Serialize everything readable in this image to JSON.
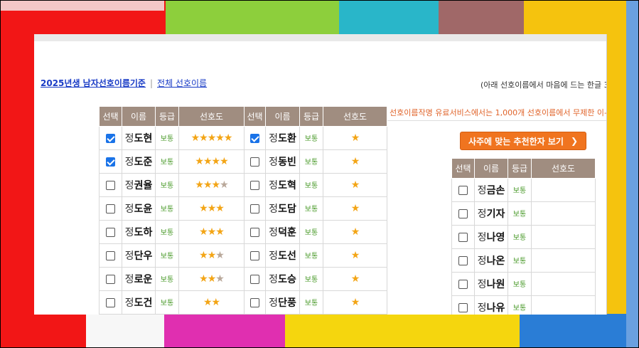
{
  "links": {
    "primary": "2025년생 남자선호이름기준",
    "separator": "|",
    "secondary": "전체 선호이름"
  },
  "note": "(아래 선호이름에서 마음에 드는 한글 3",
  "promo": "선호이름작명 유료서비스에서는 1,000개 선호이름에서 무제한 이-",
  "button": {
    "label": "사주에 맞는 추천한자 보기",
    "icon": "chevron-right-icon"
  },
  "headers": {
    "select": "선택",
    "name": "이름",
    "grade": "등급",
    "pref": "선호도"
  },
  "left_rows": [
    {
      "checked": true,
      "surname": "정",
      "given": "도현",
      "grade": "보통",
      "stars": 5
    },
    {
      "checked": true,
      "surname": "정",
      "given": "도준",
      "grade": "보통",
      "stars": 4
    },
    {
      "checked": false,
      "surname": "정",
      "given": "권율",
      "grade": "보통",
      "stars": 3.5
    },
    {
      "checked": false,
      "surname": "정",
      "given": "도윤",
      "grade": "보통",
      "stars": 3
    },
    {
      "checked": false,
      "surname": "정",
      "given": "도하",
      "grade": "보통",
      "stars": 3
    },
    {
      "checked": false,
      "surname": "정",
      "given": "단우",
      "grade": "보통",
      "stars": 2.5
    },
    {
      "checked": false,
      "surname": "정",
      "given": "로운",
      "grade": "보통",
      "stars": 2.5
    },
    {
      "checked": false,
      "surname": "정",
      "given": "도건",
      "grade": "보통",
      "stars": 2
    }
  ],
  "mid_rows": [
    {
      "checked": true,
      "surname": "정",
      "given": "도환",
      "grade": "보통",
      "stars": 1
    },
    {
      "checked": false,
      "surname": "정",
      "given": "동빈",
      "grade": "보통",
      "stars": 1
    },
    {
      "checked": false,
      "surname": "정",
      "given": "도혁",
      "grade": "보통",
      "stars": 1
    },
    {
      "checked": false,
      "surname": "정",
      "given": "도담",
      "grade": "보통",
      "stars": 1
    },
    {
      "checked": false,
      "surname": "정",
      "given": "덕훈",
      "grade": "보통",
      "stars": 1
    },
    {
      "checked": false,
      "surname": "정",
      "given": "도선",
      "grade": "보통",
      "stars": 1
    },
    {
      "checked": false,
      "surname": "정",
      "given": "도승",
      "grade": "보통",
      "stars": 1
    },
    {
      "checked": false,
      "surname": "정",
      "given": "단풍",
      "grade": "보통",
      "stars": 1
    }
  ],
  "right_rows": [
    {
      "checked": false,
      "surname": "정",
      "given": "금손",
      "grade": "보통"
    },
    {
      "checked": false,
      "surname": "정",
      "given": "기자",
      "grade": "보통"
    },
    {
      "checked": false,
      "surname": "정",
      "given": "나영",
      "grade": "보통"
    },
    {
      "checked": false,
      "surname": "정",
      "given": "나온",
      "grade": "보통"
    },
    {
      "checked": false,
      "surname": "정",
      "given": "나원",
      "grade": "보통"
    },
    {
      "checked": false,
      "surname": "정",
      "given": "나유",
      "grade": "보통"
    }
  ],
  "colors": {
    "header_bg": "#a08d80",
    "grade": "#4a9a2a",
    "button": "#f0741f",
    "promo": "#e0642a",
    "link": "#1a3cc6",
    "star": "#f3a516"
  }
}
